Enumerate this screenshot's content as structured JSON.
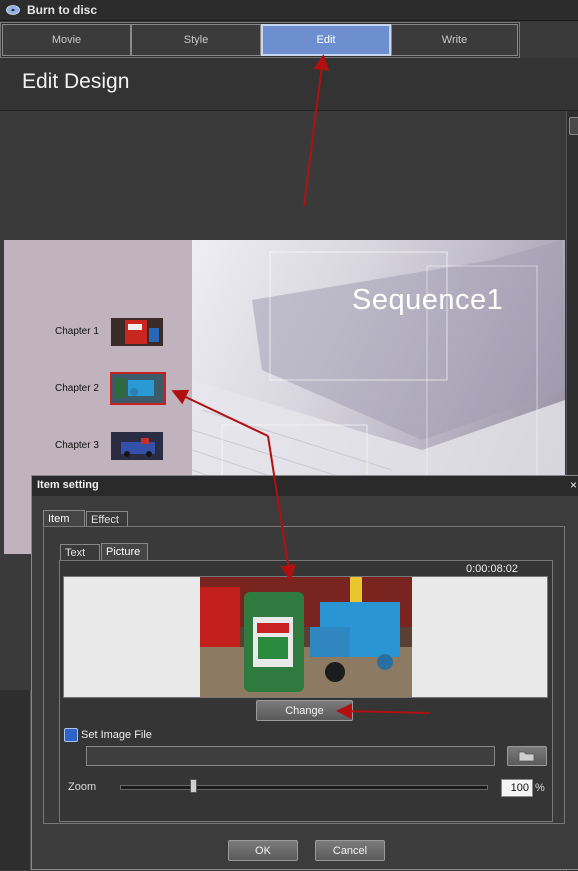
{
  "window": {
    "title": "Burn to disc",
    "icon": "disc-burn-icon"
  },
  "tabs": [
    {
      "label": "Movie",
      "active": false
    },
    {
      "label": "Style",
      "active": false
    },
    {
      "label": "Edit",
      "active": true
    },
    {
      "label": "Write",
      "active": false
    }
  ],
  "header": {
    "title": "Edit Design"
  },
  "menu_preview": {
    "title": "Sequence1",
    "chapters": [
      {
        "label": "Chapter 1",
        "selected": false
      },
      {
        "label": "Chapter 2",
        "selected": true
      },
      {
        "label": "Chapter 3",
        "selected": false
      }
    ]
  },
  "dialog": {
    "title": "Item setting",
    "close_glyph": "×",
    "tabs": [
      "Item",
      "Effect"
    ],
    "subtabs": [
      "Text",
      "Picture"
    ],
    "timecode": "0:00:08:02",
    "change_label": "Change",
    "set_image_label": "Set Image File",
    "set_image_checked": true,
    "file_path": "",
    "zoom_label": "Zoom",
    "zoom_value": "100",
    "zoom_unit": "%",
    "zoom_slider_fraction": 0.2,
    "ok_label": "OK",
    "cancel_label": "Cancel"
  },
  "colors": {
    "accent": "#6d8fcf",
    "arrow": "#b01010",
    "checkbox": "#2e63c9"
  }
}
